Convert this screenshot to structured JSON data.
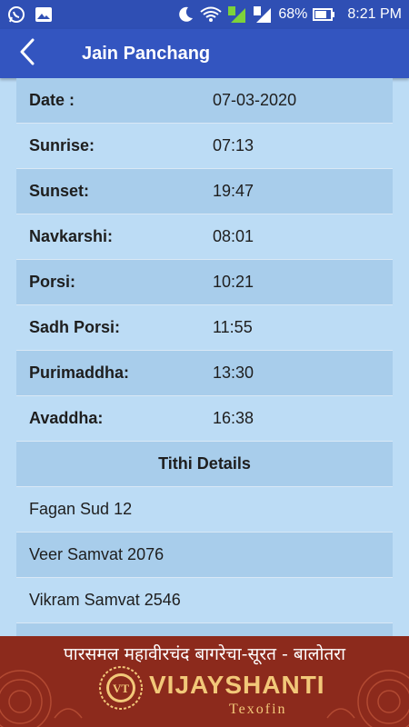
{
  "status_bar": {
    "battery_percent": "68%",
    "time": "8:21 PM"
  },
  "app_bar": {
    "title": "Jain Panchang"
  },
  "panchang": [
    {
      "label": "Date :",
      "value": "07-03-2020"
    },
    {
      "label": "Sunrise:",
      "value": "07:13"
    },
    {
      "label": "Sunset:",
      "value": "19:47"
    },
    {
      "label": "Navkarshi:",
      "value": "08:01"
    },
    {
      "label": "Porsi:",
      "value": "10:21"
    },
    {
      "label": "Sadh Porsi:",
      "value": "11:55"
    },
    {
      "label": "Purimaddha:",
      "value": "13:30"
    },
    {
      "label": "Avaddha:",
      "value": "16:38"
    }
  ],
  "tithi": {
    "header": "Tithi Details",
    "items": [
      "Fagan Sud 12",
      "Veer Samvat 2076",
      "Vikram Samvat 2546"
    ]
  },
  "banner": {
    "line1": "पारसमल महावीरचंद बागरेचा-सूरत - बालोतरा",
    "brand": "VIJAYSHANTI",
    "sub": "Texofin",
    "logo_text": "VT",
    "colors": {
      "background": "#8c2a1c",
      "gold": "#f2c879"
    }
  },
  "colors": {
    "status_bar": "#2f4fb4",
    "app_bar": "#3355c0",
    "row_alt": "#a8cdeb",
    "row_plain": "#bcdcf5"
  }
}
